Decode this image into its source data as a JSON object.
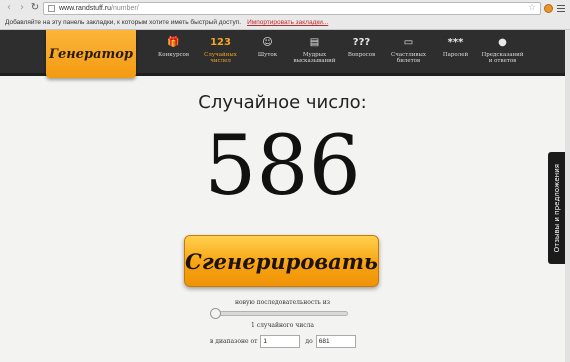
{
  "browser": {
    "url_host": "www.randstuff.ru",
    "url_path": "/number/",
    "bookmarks_hint": "Добавляйте на эту панель закладки, к которым хотите иметь быстрый доступ.",
    "import_link": "Импортировать закладки..."
  },
  "site": {
    "logo": "Генератор",
    "nav": [
      {
        "icon": "🎁",
        "label": "Конкурсов",
        "active": false
      },
      {
        "icon": "123",
        "label": "Случайных числел",
        "active": true
      },
      {
        "icon": "☺",
        "label": "Шуток",
        "active": false
      },
      {
        "icon": "▤",
        "label": "Мудрых высказываний",
        "active": false
      },
      {
        "icon": "???",
        "label": "Вопросов",
        "active": false
      },
      {
        "icon": "▭",
        "label": "Счастливых билетов",
        "active": false
      },
      {
        "icon": "***",
        "label": "Паролей",
        "active": false
      },
      {
        "icon": "●",
        "label": "Предсказаний и ответов",
        "active": false
      }
    ]
  },
  "main": {
    "heading": "Случайное число:",
    "number": "586",
    "generate_button": "Сгенерировать",
    "sequence_label": "новую последовательность из",
    "slider_value": 1,
    "count_label": "1 случайного числа",
    "range_from_label": "в диапазоне от",
    "range_from": "1",
    "range_to_label": "до",
    "range_to": "681"
  },
  "feedback_tab": "Отзывы и предложения"
}
